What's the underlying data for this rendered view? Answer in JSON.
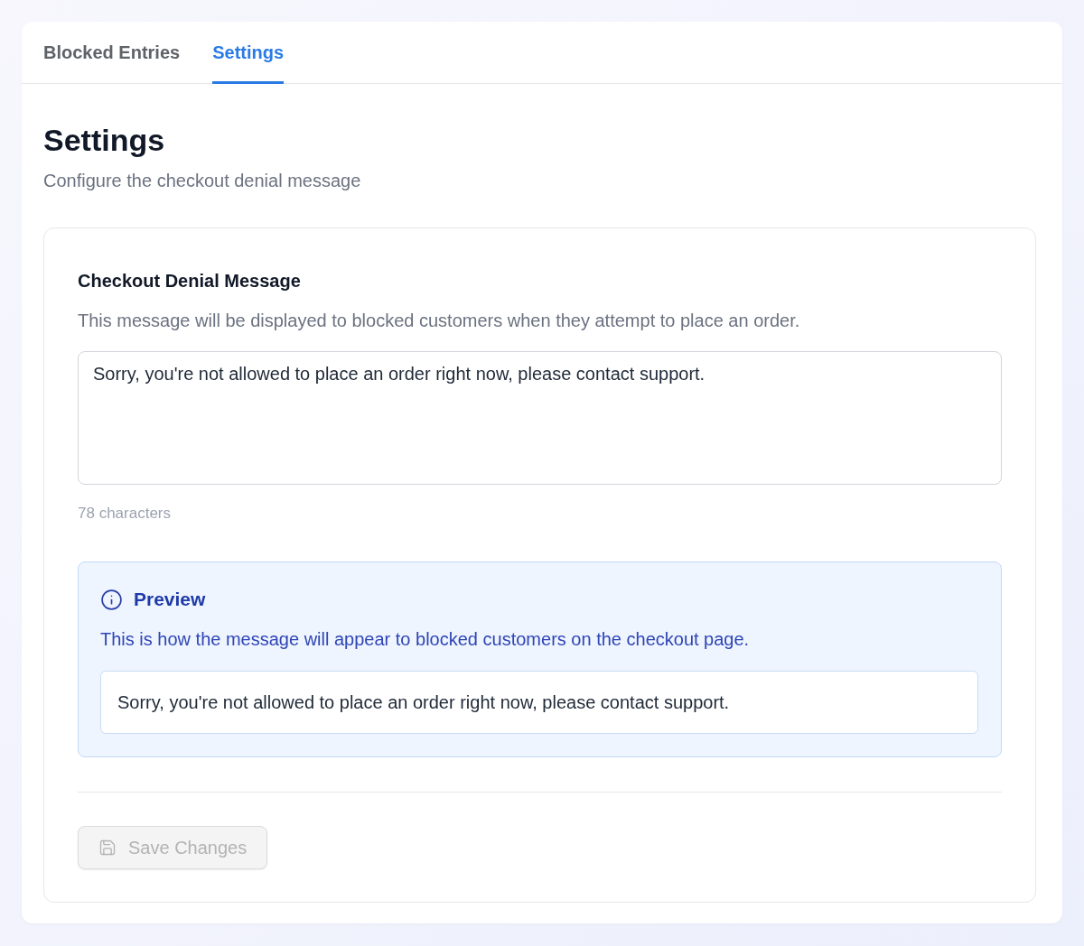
{
  "tabs": [
    {
      "label": "Blocked Entries",
      "selected": false
    },
    {
      "label": "Settings",
      "selected": true
    }
  ],
  "header": {
    "title": "Settings",
    "subtitle": "Configure the checkout denial message"
  },
  "message_section": {
    "title": "Checkout Denial Message",
    "description": "This message will be displayed to blocked customers when they attempt to place an order.",
    "textarea": {
      "value": "Sorry, you're not allowed to place an order right now, please contact support."
    },
    "char_count": "78 characters"
  },
  "preview": {
    "title": "Preview",
    "description": "This is how the message will appear to blocked customers on the checkout page.",
    "message": "Sorry, you're not allowed to place an order right now, please contact support."
  },
  "save_button": {
    "label": "Save Changes",
    "disabled": true
  }
}
